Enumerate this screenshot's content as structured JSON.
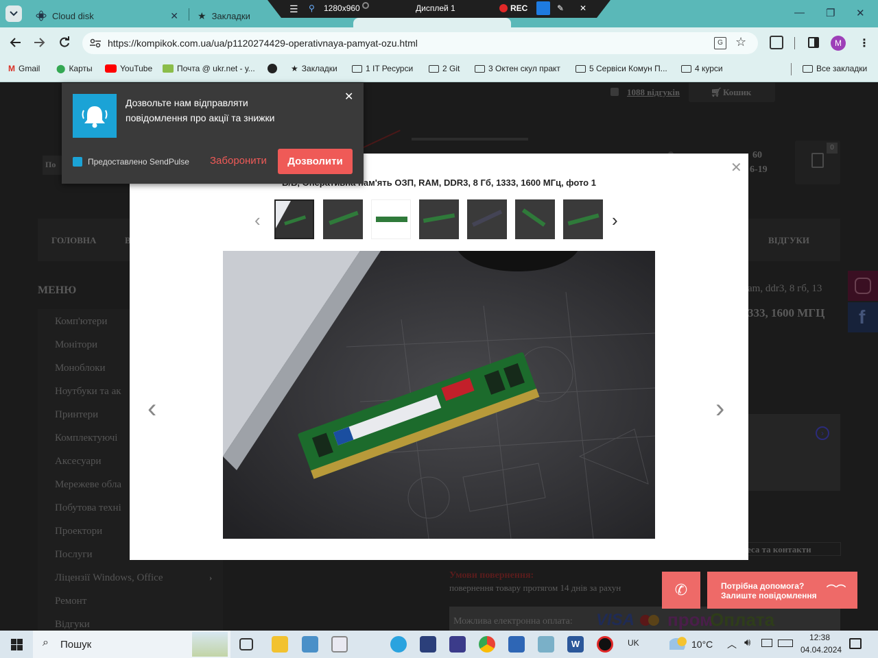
{
  "browser": {
    "tabs": [
      {
        "title": "Cloud disk"
      },
      {
        "title": "Закладки"
      }
    ],
    "recorder": {
      "resolution": "1280x960",
      "display": "Дисплей 1",
      "rec": "REC"
    },
    "url": "https://kompikok.com.ua/ua/p1120274429-operativnaya-pamyat-ozu.html",
    "profile_initial": "M",
    "bookmarks": [
      "Gmail",
      "Карты",
      "YouTube",
      "Почта @ ukr.net - у...",
      "Закладки",
      "1 IT Ресурси",
      "2 Git",
      "3 Октен скул практ",
      "5 Сервіси Комун П...",
      "4 курси",
      "Все закладки"
    ]
  },
  "site": {
    "reviews_link": "1088 відгуків",
    "cart_label": "Кошик",
    "cart_count": "0",
    "phone_partial_1": "60",
    "phone_partial_2": "6-19",
    "nav_home": "ГОЛОВНА",
    "nav_b": "В",
    "nav_reviews": "ВІДГУКИ",
    "menu_title": "МЕНЮ",
    "menu_items": [
      "Комп'ютери",
      "Монітори",
      "Моноблоки",
      "Ноутбуки та ак",
      "Принтери",
      "Комплектуючі",
      "Аксесуари",
      "Мережеве обла",
      "Побутова техні",
      "Проектори",
      "Послуги",
      "Ліцензії Windows, Office",
      "Ремонт",
      "Відгуки"
    ],
    "product_title_partial_1": "am, ddr3, 8 гб, 13",
    "product_title_partial_2": "333, 1600 МГЦ",
    "address_link": "еса та контакти",
    "return_title": "Умови повернення:",
    "return_text": "повернення товару протягом 14 днів за рахун",
    "payment_label": "Можлива електронна оплата:",
    "payment_visa": "VISA",
    "payment_prom": "пром",
    "payment_oplata": "Оплата"
  },
  "notification": {
    "text": "Дозвольте нам відправляти повідомлення про акції та знижки",
    "provider": "Предоставлено SendPulse",
    "deny": "Заборонити",
    "allow": "Дозволити"
  },
  "modal": {
    "title": "Б/В, Оперативна пам'ять ОЗП, RAM, DDR3, 8 Гб, 1333, 1600 МГц, фото 1",
    "thumbnail_count": 7,
    "selected_thumbnail": 1
  },
  "help_widget": {
    "line1": "Потрібна допомога?",
    "line2": "Залиште повідомлення"
  },
  "taskbar": {
    "search": "Пошук",
    "language": "UK",
    "temperature": "10°C",
    "time": "12:38",
    "date": "04.04.2024"
  },
  "colors": {
    "tabbar": "#5ab8b8",
    "toolbar": "#dff0f0",
    "allow_button": "#ef5a57",
    "help_widget": "#ee6a68",
    "notif_icon_bg": "#1ba3d6"
  }
}
